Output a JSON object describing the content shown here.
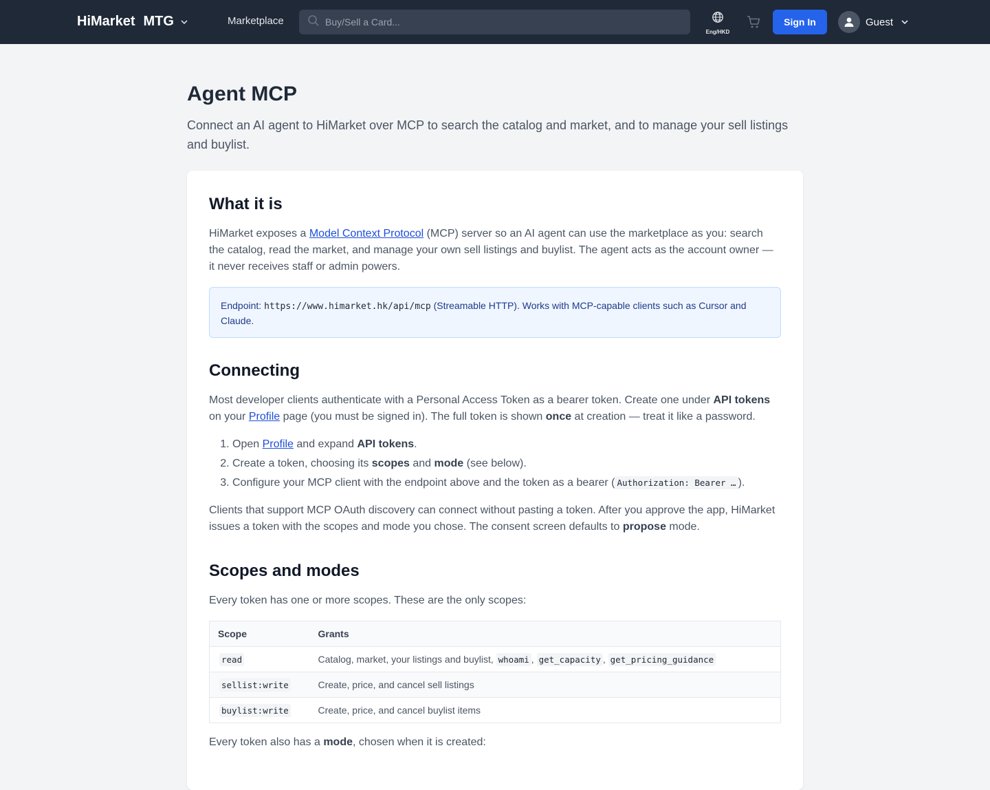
{
  "header": {
    "brand": "HiMarket",
    "game": "MTG",
    "nav_marketplace": "Marketplace",
    "search_placeholder": "Buy/Sell a Card...",
    "locale_label": "Eng/HKD",
    "sign_in": "Sign In",
    "user_name": "Guest",
    "accent_color": "#2563eb"
  },
  "page": {
    "title": "Agent MCP",
    "subtitle": "Connect an AI agent to HiMarket over MCP to search the catalog and market, and to manage your sell listings and buylist."
  },
  "what": {
    "heading": "What it is",
    "p1_a": "HiMarket exposes a ",
    "p1_link": "Model Context Protocol",
    "p1_b": " (MCP) server so an AI agent can use the marketplace as you: search the catalog, read the market, and manage your own sell listings and buylist. The agent acts as the account owner — it never receives staff or admin powers.",
    "endpoint_label": "Endpoint: ",
    "endpoint_url": "https://www.himarket.hk/api/mcp",
    "endpoint_rest": " (Streamable HTTP). Works with MCP-capable clients such as Cursor and Claude."
  },
  "connecting": {
    "heading": "Connecting",
    "p1_a": "Most developer clients authenticate with a Personal Access Token as a bearer token. Create one under ",
    "p1_bold1": "API tokens",
    "p1_b": " on your ",
    "p1_link": "Profile",
    "p1_c": " page (you must be signed in). The full token is shown ",
    "p1_bold2": "once",
    "p1_d": " at creation — treat it like a password.",
    "step1_a": "Open ",
    "step1_link": "Profile",
    "step1_b": " and expand ",
    "step1_bold": "API tokens",
    "step1_c": ".",
    "step2_a": "Create a token, choosing its ",
    "step2_bold1": "scopes",
    "step2_b": " and ",
    "step2_bold2": "mode",
    "step2_c": " (see below).",
    "step3_a": "Configure your MCP client with the endpoint above and the token as a bearer (",
    "step3_code": "Authorization: Bearer …",
    "step3_b": ").",
    "p2_a": "Clients that support MCP OAuth discovery can connect without pasting a token. After you approve the app, HiMarket issues a token with the scopes and mode you chose. The consent screen defaults to ",
    "p2_bold": "propose",
    "p2_b": " mode."
  },
  "scopes": {
    "heading": "Scopes and modes",
    "intro": "Every token has one or more scopes. These are the only scopes:",
    "col_scope": "Scope",
    "col_grants": "Grants",
    "row1_scope": "read",
    "row1_grant": "Catalog, market, your listings and buylist, ",
    "row1_code1": "whoami",
    "row1_sep1": ", ",
    "row1_code2": "get_capacity",
    "row1_sep2": ", ",
    "row1_code3": "get_pricing_guidance",
    "row2_scope": "sellist:write",
    "row2_grant": "Create, price, and cancel sell listings",
    "row3_scope": "buylist:write",
    "row3_grant": "Create, price, and cancel buylist items",
    "mode_a": "Every token also has a ",
    "mode_bold": "mode",
    "mode_b": ", chosen when it is created:"
  }
}
